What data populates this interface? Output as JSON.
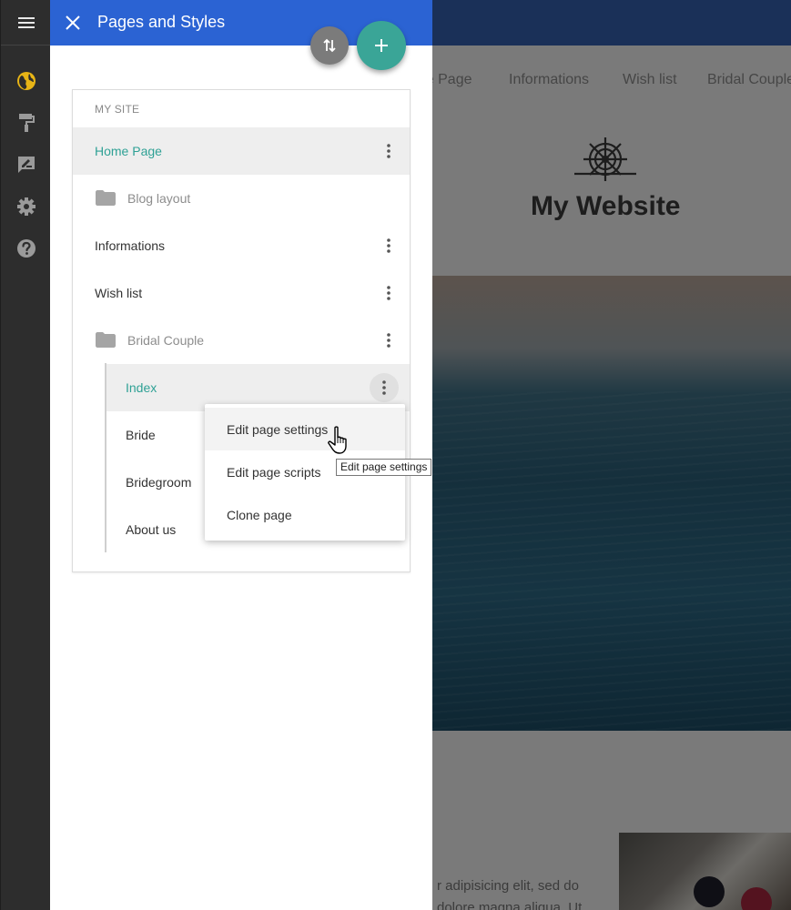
{
  "panel": {
    "title": "Pages and Styles",
    "section_label": "MY SITE",
    "pages": [
      {
        "label": "Home Page",
        "state": "active"
      },
      {
        "label": "Blog layout",
        "type": "folder",
        "expanded": false
      },
      {
        "label": "Informations"
      },
      {
        "label": "Wish list"
      },
      {
        "label": "Bridal Couple",
        "type": "folder",
        "expanded": true
      },
      {
        "label": "Index",
        "state": "active"
      },
      {
        "label": "Bride"
      },
      {
        "label": "Bridegroom"
      },
      {
        "label": "About us"
      }
    ]
  },
  "context_menu": {
    "items": [
      {
        "label": "Edit page settings"
      },
      {
        "label": "Edit page scripts"
      },
      {
        "label": "Clone page"
      }
    ]
  },
  "tooltip": "Edit page settings",
  "site": {
    "nav": [
      "Home Page",
      "Informations",
      "Wish list",
      "Bridal Couple"
    ],
    "title": "My Website",
    "body_text_line1": "r adipisicing elit, sed do",
    "body_text_line2": "dolore magna aliqua. Ut"
  },
  "icons": {
    "rail": [
      "menu-icon",
      "globe-icon",
      "paint-roller-icon",
      "feedback-icon",
      "gear-icon",
      "help-icon"
    ],
    "panel": [
      "close-icon",
      "sort-icon",
      "add-icon",
      "more-vert-icon",
      "folder-icon"
    ]
  },
  "colors": {
    "header_blue": "#2b63d3",
    "accent_teal": "#3aa597",
    "active_text": "#2fa195",
    "rail_bg": "#2d2d2d",
    "globe_yellow": "#e8b516"
  }
}
